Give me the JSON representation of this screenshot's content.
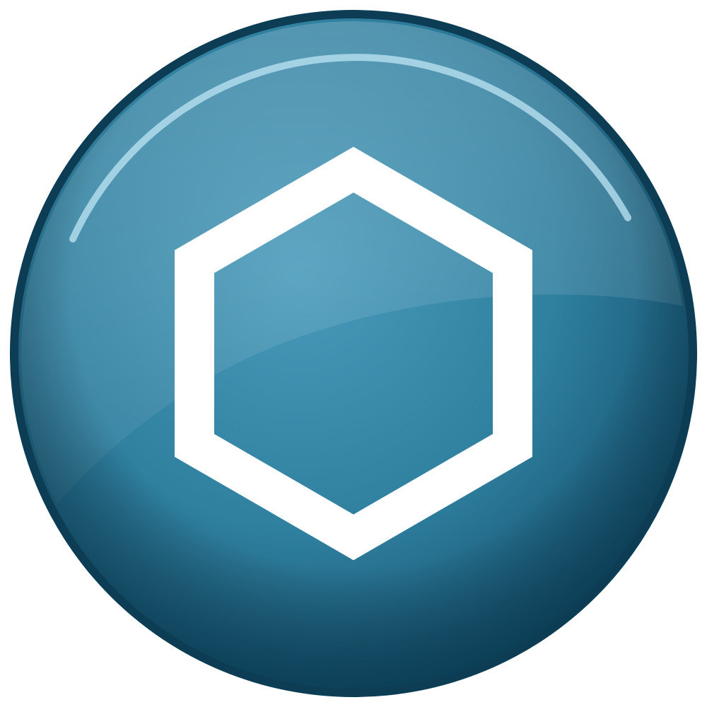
{
  "button": {
    "icon": "hexagon-icon",
    "colors": {
      "base_light": "#4a9bbb",
      "base_mid": "#2f7f9f",
      "base_dark": "#0f4a66",
      "rim_highlight": "#bfe6f5",
      "glyph": "#ffffff",
      "background": "#ffffff"
    }
  }
}
